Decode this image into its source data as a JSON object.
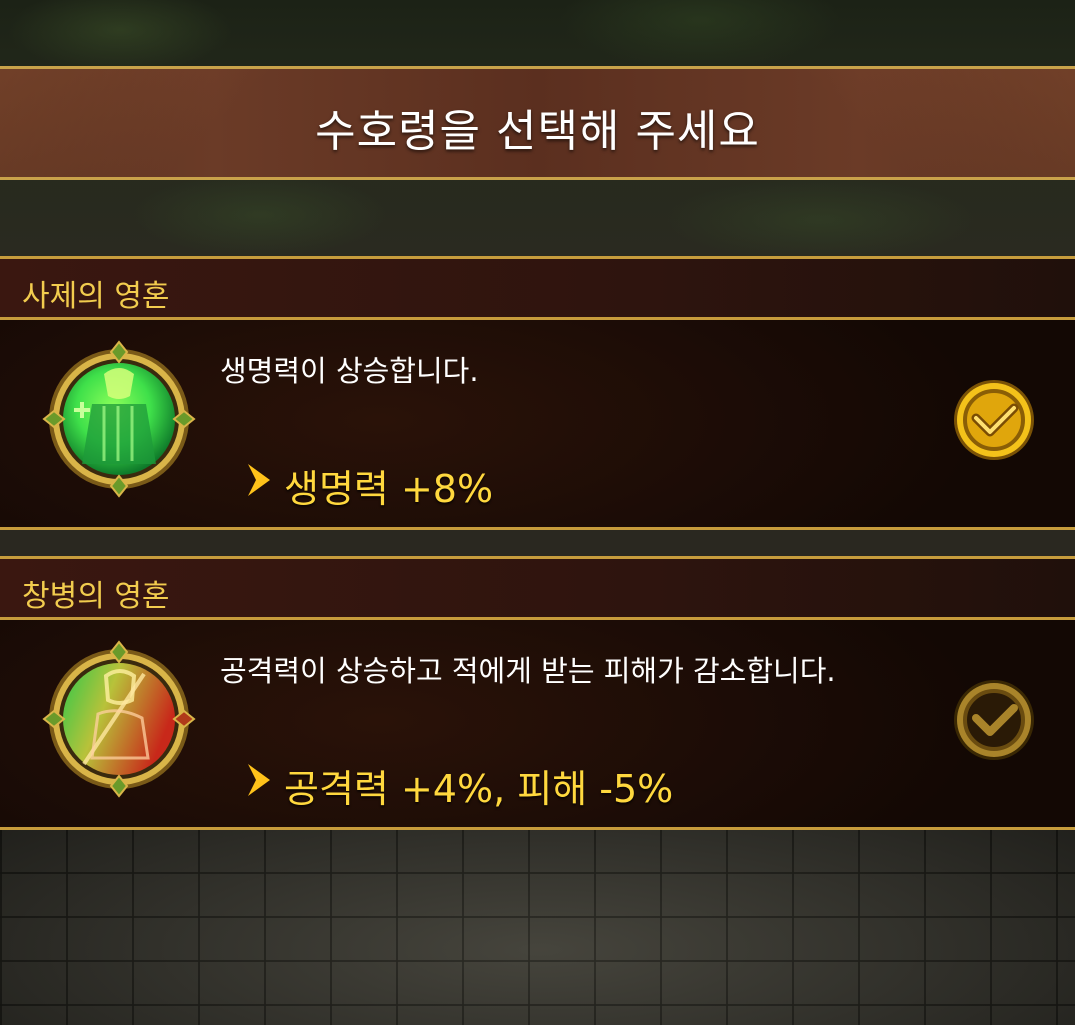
{
  "title": "수호령을 선택해 주세요",
  "options": [
    {
      "name": "사제의 영혼",
      "description": "생명력이 상승합니다.",
      "bonus": "생명력 +8%",
      "portrait_icon": "priest-spirit-icon",
      "selected": true,
      "colors": {
        "inner_a": "#3fe04a",
        "inner_b": "#0e7a2a",
        "check": "#f4c21a"
      }
    },
    {
      "name": "창병의 영혼",
      "description": "공격력이 상승하고 적에게 받는 피해가 감소합니다.",
      "bonus": "공격력 +4%, 피해 -5%",
      "portrait_icon": "spearman-spirit-icon",
      "selected": false,
      "colors": {
        "inner_a": "#2ec84a",
        "inner_b": "#c8281a",
        "check": "#a9842a"
      }
    }
  ],
  "colors": {
    "gold": "#c79c3c",
    "name_text": "#f2cc4e",
    "bonus_text": "#ffd83e"
  }
}
